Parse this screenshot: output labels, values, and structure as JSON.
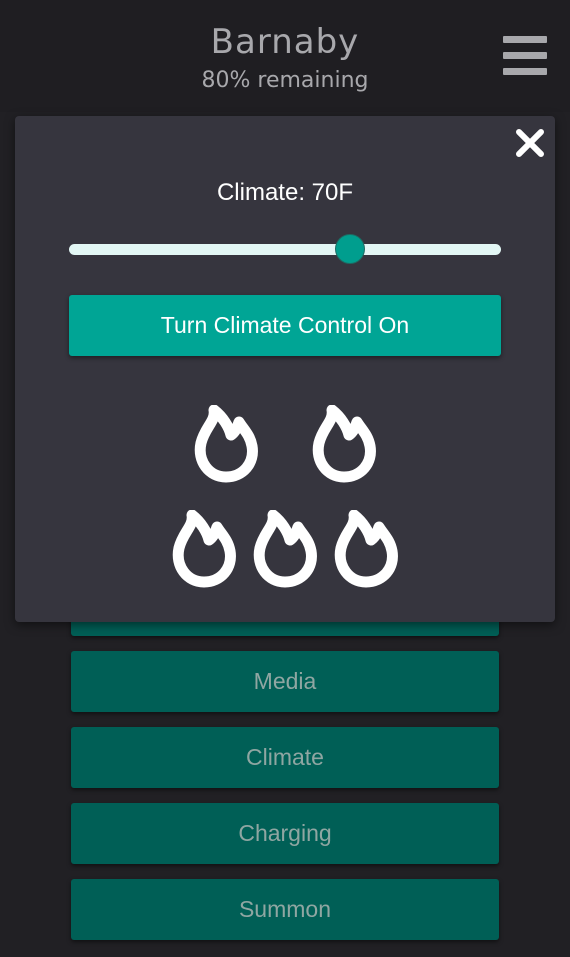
{
  "header": {
    "title": "Barnaby",
    "subtitle": "80% remaining",
    "menu_icon": "hamburger-menu-icon"
  },
  "nav": {
    "items": [
      {
        "label": ""
      },
      {
        "label": "Media"
      },
      {
        "label": "Climate"
      },
      {
        "label": "Charging"
      },
      {
        "label": "Summon"
      }
    ]
  },
  "climate_modal": {
    "close_icon": "close-icon",
    "label": "Climate: 70F",
    "slider_level_percent": 65,
    "toggle_label": "Turn Climate Control On",
    "heat_icon": "flame-icon",
    "heat_icon_count": 5
  },
  "colors": {
    "background": "#212024",
    "header": "#1f1e22",
    "modal": "#36353e",
    "accent": "#00a595",
    "nav_button": "#005f56",
    "slider_track": "#e3f7f5",
    "muted_text": "#a8a8ac"
  }
}
